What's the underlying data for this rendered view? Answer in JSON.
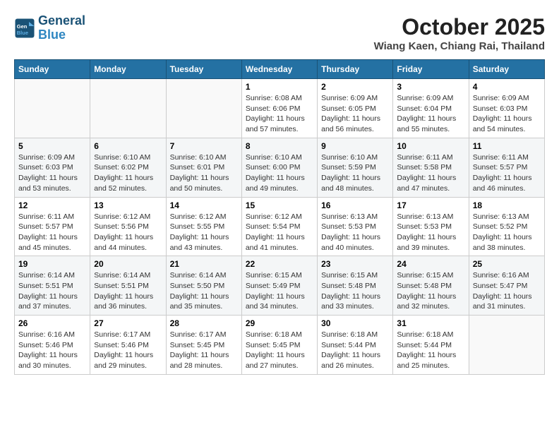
{
  "header": {
    "logo_line1": "General",
    "logo_line2": "Blue",
    "month": "October 2025",
    "location": "Wiang Kaen, Chiang Rai, Thailand"
  },
  "weekdays": [
    "Sunday",
    "Monday",
    "Tuesday",
    "Wednesday",
    "Thursday",
    "Friday",
    "Saturday"
  ],
  "weeks": [
    [
      {
        "day": "",
        "info": ""
      },
      {
        "day": "",
        "info": ""
      },
      {
        "day": "",
        "info": ""
      },
      {
        "day": "1",
        "info": "Sunrise: 6:08 AM\nSunset: 6:06 PM\nDaylight: 11 hours and 57 minutes."
      },
      {
        "day": "2",
        "info": "Sunrise: 6:09 AM\nSunset: 6:05 PM\nDaylight: 11 hours and 56 minutes."
      },
      {
        "day": "3",
        "info": "Sunrise: 6:09 AM\nSunset: 6:04 PM\nDaylight: 11 hours and 55 minutes."
      },
      {
        "day": "4",
        "info": "Sunrise: 6:09 AM\nSunset: 6:03 PM\nDaylight: 11 hours and 54 minutes."
      }
    ],
    [
      {
        "day": "5",
        "info": "Sunrise: 6:09 AM\nSunset: 6:03 PM\nDaylight: 11 hours and 53 minutes."
      },
      {
        "day": "6",
        "info": "Sunrise: 6:10 AM\nSunset: 6:02 PM\nDaylight: 11 hours and 52 minutes."
      },
      {
        "day": "7",
        "info": "Sunrise: 6:10 AM\nSunset: 6:01 PM\nDaylight: 11 hours and 50 minutes."
      },
      {
        "day": "8",
        "info": "Sunrise: 6:10 AM\nSunset: 6:00 PM\nDaylight: 11 hours and 49 minutes."
      },
      {
        "day": "9",
        "info": "Sunrise: 6:10 AM\nSunset: 5:59 PM\nDaylight: 11 hours and 48 minutes."
      },
      {
        "day": "10",
        "info": "Sunrise: 6:11 AM\nSunset: 5:58 PM\nDaylight: 11 hours and 47 minutes."
      },
      {
        "day": "11",
        "info": "Sunrise: 6:11 AM\nSunset: 5:57 PM\nDaylight: 11 hours and 46 minutes."
      }
    ],
    [
      {
        "day": "12",
        "info": "Sunrise: 6:11 AM\nSunset: 5:57 PM\nDaylight: 11 hours and 45 minutes."
      },
      {
        "day": "13",
        "info": "Sunrise: 6:12 AM\nSunset: 5:56 PM\nDaylight: 11 hours and 44 minutes."
      },
      {
        "day": "14",
        "info": "Sunrise: 6:12 AM\nSunset: 5:55 PM\nDaylight: 11 hours and 43 minutes."
      },
      {
        "day": "15",
        "info": "Sunrise: 6:12 AM\nSunset: 5:54 PM\nDaylight: 11 hours and 41 minutes."
      },
      {
        "day": "16",
        "info": "Sunrise: 6:13 AM\nSunset: 5:53 PM\nDaylight: 11 hours and 40 minutes."
      },
      {
        "day": "17",
        "info": "Sunrise: 6:13 AM\nSunset: 5:53 PM\nDaylight: 11 hours and 39 minutes."
      },
      {
        "day": "18",
        "info": "Sunrise: 6:13 AM\nSunset: 5:52 PM\nDaylight: 11 hours and 38 minutes."
      }
    ],
    [
      {
        "day": "19",
        "info": "Sunrise: 6:14 AM\nSunset: 5:51 PM\nDaylight: 11 hours and 37 minutes."
      },
      {
        "day": "20",
        "info": "Sunrise: 6:14 AM\nSunset: 5:51 PM\nDaylight: 11 hours and 36 minutes."
      },
      {
        "day": "21",
        "info": "Sunrise: 6:14 AM\nSunset: 5:50 PM\nDaylight: 11 hours and 35 minutes."
      },
      {
        "day": "22",
        "info": "Sunrise: 6:15 AM\nSunset: 5:49 PM\nDaylight: 11 hours and 34 minutes."
      },
      {
        "day": "23",
        "info": "Sunrise: 6:15 AM\nSunset: 5:48 PM\nDaylight: 11 hours and 33 minutes."
      },
      {
        "day": "24",
        "info": "Sunrise: 6:15 AM\nSunset: 5:48 PM\nDaylight: 11 hours and 32 minutes."
      },
      {
        "day": "25",
        "info": "Sunrise: 6:16 AM\nSunset: 5:47 PM\nDaylight: 11 hours and 31 minutes."
      }
    ],
    [
      {
        "day": "26",
        "info": "Sunrise: 6:16 AM\nSunset: 5:46 PM\nDaylight: 11 hours and 30 minutes."
      },
      {
        "day": "27",
        "info": "Sunrise: 6:17 AM\nSunset: 5:46 PM\nDaylight: 11 hours and 29 minutes."
      },
      {
        "day": "28",
        "info": "Sunrise: 6:17 AM\nSunset: 5:45 PM\nDaylight: 11 hours and 28 minutes."
      },
      {
        "day": "29",
        "info": "Sunrise: 6:18 AM\nSunset: 5:45 PM\nDaylight: 11 hours and 27 minutes."
      },
      {
        "day": "30",
        "info": "Sunrise: 6:18 AM\nSunset: 5:44 PM\nDaylight: 11 hours and 26 minutes."
      },
      {
        "day": "31",
        "info": "Sunrise: 6:18 AM\nSunset: 5:44 PM\nDaylight: 11 hours and 25 minutes."
      },
      {
        "day": "",
        "info": ""
      }
    ]
  ]
}
